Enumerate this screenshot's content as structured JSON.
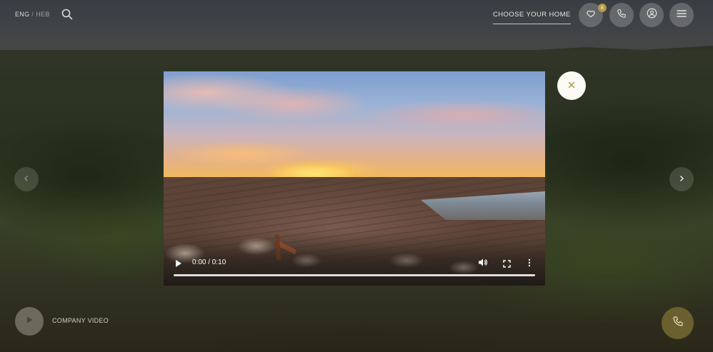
{
  "header": {
    "lang_active": "ENG",
    "lang_sep": "/",
    "lang_inactive": "HEB",
    "choose_home": "CHOOSE YOUR HOME",
    "favorites_count": "8"
  },
  "icons": {
    "search": "search-icon",
    "heart": "heart-icon",
    "phone": "phone-icon",
    "user": "user-icon",
    "menu": "menu-icon",
    "close": "close-icon",
    "play": "play-icon"
  },
  "video": {
    "time": "0:00 / 0:10",
    "progress": 0
  },
  "bottom": {
    "company_video": "COMPANY VIDEO"
  },
  "colors": {
    "accent_gold": "#b09a45",
    "close_button_bg": "#fbfaf5",
    "close_icon": "#b09a45",
    "phone_float_bg": "#6a5f2e"
  }
}
